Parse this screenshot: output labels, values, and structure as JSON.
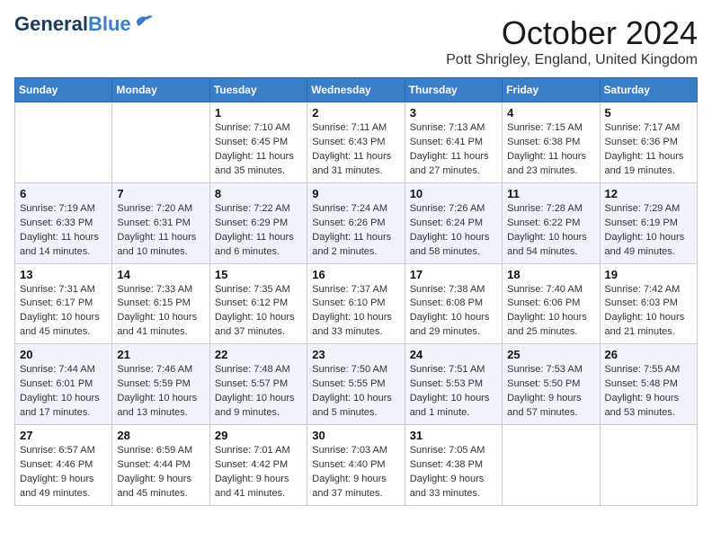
{
  "header": {
    "logo_line1": "General",
    "logo_line2": "Blue",
    "month_title": "October 2024",
    "location": "Pott Shrigley, England, United Kingdom"
  },
  "weekdays": [
    "Sunday",
    "Monday",
    "Tuesday",
    "Wednesday",
    "Thursday",
    "Friday",
    "Saturday"
  ],
  "weeks": [
    [
      {
        "day": "",
        "info": ""
      },
      {
        "day": "",
        "info": ""
      },
      {
        "day": "1",
        "info": "Sunrise: 7:10 AM\nSunset: 6:45 PM\nDaylight: 11 hours and 35 minutes."
      },
      {
        "day": "2",
        "info": "Sunrise: 7:11 AM\nSunset: 6:43 PM\nDaylight: 11 hours and 31 minutes."
      },
      {
        "day": "3",
        "info": "Sunrise: 7:13 AM\nSunset: 6:41 PM\nDaylight: 11 hours and 27 minutes."
      },
      {
        "day": "4",
        "info": "Sunrise: 7:15 AM\nSunset: 6:38 PM\nDaylight: 11 hours and 23 minutes."
      },
      {
        "day": "5",
        "info": "Sunrise: 7:17 AM\nSunset: 6:36 PM\nDaylight: 11 hours and 19 minutes."
      }
    ],
    [
      {
        "day": "6",
        "info": "Sunrise: 7:19 AM\nSunset: 6:33 PM\nDaylight: 11 hours and 14 minutes."
      },
      {
        "day": "7",
        "info": "Sunrise: 7:20 AM\nSunset: 6:31 PM\nDaylight: 11 hours and 10 minutes."
      },
      {
        "day": "8",
        "info": "Sunrise: 7:22 AM\nSunset: 6:29 PM\nDaylight: 11 hours and 6 minutes."
      },
      {
        "day": "9",
        "info": "Sunrise: 7:24 AM\nSunset: 6:26 PM\nDaylight: 11 hours and 2 minutes."
      },
      {
        "day": "10",
        "info": "Sunrise: 7:26 AM\nSunset: 6:24 PM\nDaylight: 10 hours and 58 minutes."
      },
      {
        "day": "11",
        "info": "Sunrise: 7:28 AM\nSunset: 6:22 PM\nDaylight: 10 hours and 54 minutes."
      },
      {
        "day": "12",
        "info": "Sunrise: 7:29 AM\nSunset: 6:19 PM\nDaylight: 10 hours and 49 minutes."
      }
    ],
    [
      {
        "day": "13",
        "info": "Sunrise: 7:31 AM\nSunset: 6:17 PM\nDaylight: 10 hours and 45 minutes."
      },
      {
        "day": "14",
        "info": "Sunrise: 7:33 AM\nSunset: 6:15 PM\nDaylight: 10 hours and 41 minutes."
      },
      {
        "day": "15",
        "info": "Sunrise: 7:35 AM\nSunset: 6:12 PM\nDaylight: 10 hours and 37 minutes."
      },
      {
        "day": "16",
        "info": "Sunrise: 7:37 AM\nSunset: 6:10 PM\nDaylight: 10 hours and 33 minutes."
      },
      {
        "day": "17",
        "info": "Sunrise: 7:38 AM\nSunset: 6:08 PM\nDaylight: 10 hours and 29 minutes."
      },
      {
        "day": "18",
        "info": "Sunrise: 7:40 AM\nSunset: 6:06 PM\nDaylight: 10 hours and 25 minutes."
      },
      {
        "day": "19",
        "info": "Sunrise: 7:42 AM\nSunset: 6:03 PM\nDaylight: 10 hours and 21 minutes."
      }
    ],
    [
      {
        "day": "20",
        "info": "Sunrise: 7:44 AM\nSunset: 6:01 PM\nDaylight: 10 hours and 17 minutes."
      },
      {
        "day": "21",
        "info": "Sunrise: 7:46 AM\nSunset: 5:59 PM\nDaylight: 10 hours and 13 minutes."
      },
      {
        "day": "22",
        "info": "Sunrise: 7:48 AM\nSunset: 5:57 PM\nDaylight: 10 hours and 9 minutes."
      },
      {
        "day": "23",
        "info": "Sunrise: 7:50 AM\nSunset: 5:55 PM\nDaylight: 10 hours and 5 minutes."
      },
      {
        "day": "24",
        "info": "Sunrise: 7:51 AM\nSunset: 5:53 PM\nDaylight: 10 hours and 1 minute."
      },
      {
        "day": "25",
        "info": "Sunrise: 7:53 AM\nSunset: 5:50 PM\nDaylight: 9 hours and 57 minutes."
      },
      {
        "day": "26",
        "info": "Sunrise: 7:55 AM\nSunset: 5:48 PM\nDaylight: 9 hours and 53 minutes."
      }
    ],
    [
      {
        "day": "27",
        "info": "Sunrise: 6:57 AM\nSunset: 4:46 PM\nDaylight: 9 hours and 49 minutes."
      },
      {
        "day": "28",
        "info": "Sunrise: 6:59 AM\nSunset: 4:44 PM\nDaylight: 9 hours and 45 minutes."
      },
      {
        "day": "29",
        "info": "Sunrise: 7:01 AM\nSunset: 4:42 PM\nDaylight: 9 hours and 41 minutes."
      },
      {
        "day": "30",
        "info": "Sunrise: 7:03 AM\nSunset: 4:40 PM\nDaylight: 9 hours and 37 minutes."
      },
      {
        "day": "31",
        "info": "Sunrise: 7:05 AM\nSunset: 4:38 PM\nDaylight: 9 hours and 33 minutes."
      },
      {
        "day": "",
        "info": ""
      },
      {
        "day": "",
        "info": ""
      }
    ]
  ]
}
